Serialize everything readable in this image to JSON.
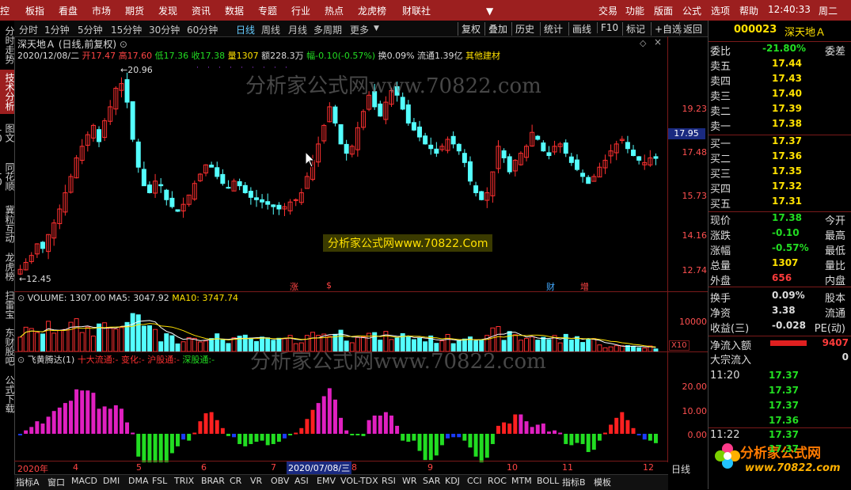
{
  "topbar": {
    "menu": [
      "控",
      "板指",
      "看盘",
      "市场",
      "期货",
      "发现",
      "资讯",
      "数据",
      "专题",
      "行业",
      "热点",
      "龙虎榜",
      "财联社"
    ],
    "right": [
      "交易",
      "功能",
      "版面",
      "公式",
      "选项",
      "帮助"
    ],
    "clock": "12:40:33",
    "weekday": "周二"
  },
  "leftnav": [
    "分时走势",
    "技术分析",
    "图文10",
    "同花顺10",
    "冀粒互动",
    "龙虎榜",
    "扫雷宝",
    "东财股吧",
    "公式下载"
  ],
  "periodbar": {
    "periods": [
      "分时",
      "1分钟",
      "5分钟",
      "15分钟",
      "30分钟",
      "60分钟",
      "日线",
      "周线",
      "月线",
      "多周期",
      "更多"
    ],
    "selected": "日线",
    "tools": [
      "复权",
      "叠加",
      "历史",
      "统计",
      "画线",
      "F10",
      "标记",
      "+自选",
      "返回"
    ]
  },
  "stock": {
    "name": "深天地Ａ",
    "mode": "(日线,前复权)",
    "date": "2020/12/08/二",
    "open_label": "开",
    "open": "17.47",
    "high_label": "高",
    "high": "17.60",
    "low_label": "低",
    "low": "17.36",
    "close_label": "收",
    "close": "17.38",
    "vol_label": "量",
    "vol": "1307",
    "amt_label": "额",
    "amt": "228.3万",
    "chg_label": "幅",
    "chg": "-0.10(-0.57%)",
    "turnover_label": "换",
    "turnover": "0.09%",
    "float_label": "流通",
    "float": "1.39亿",
    "sector": "其他建材"
  },
  "price_axis": [
    "19.23",
    "17.48",
    "15.73",
    "14.16",
    "12.74"
  ],
  "current_price_tag": "17.95",
  "price_marks": {
    "high": "20.96",
    "low": "12.45"
  },
  "event_marks": [
    "涨",
    "$",
    "财",
    "增"
  ],
  "volume": {
    "label": "VOLUME:",
    "value": "1307.00",
    "ma5_label": "MA5:",
    "ma5": "3047.92",
    "ma10_label": "MA10:",
    "ma10": "3747.74",
    "axis": "10000",
    "scale": "X10"
  },
  "indicator": {
    "name": "飞黄腾达(1)",
    "items": [
      {
        "label": "十大流通:",
        "value": "-"
      },
      {
        "label": "变化:",
        "value": "-"
      },
      {
        "label": "沪股通:",
        "value": "-"
      },
      {
        "label": "深股通:",
        "value": "-"
      }
    ],
    "axis": [
      "20.00",
      "10.00",
      "0.00"
    ]
  },
  "date_axis": {
    "year": "2020年",
    "months": [
      "4",
      "5",
      "6",
      "7",
      "8",
      "9",
      "10",
      "11",
      "12"
    ],
    "highlight": "2020/07/08/三"
  },
  "bottom_tabs": [
    "指标A",
    "窗口",
    "MACD",
    "DMI",
    "DMA",
    "FSL",
    "TRIX",
    "BRAR",
    "CR",
    "VR",
    "OBV",
    "ASI",
    "EMV",
    "VOL-TDX",
    "RSI",
    "WR",
    "SAR",
    "KDJ",
    "CCI",
    "ROC",
    "MTM",
    "BOLL",
    "指标B",
    "模板"
  ],
  "bottom_right": "日线",
  "watermarks": [
    "分析家公式网www.70822.com",
    "分析家公式网www.70822.Com",
    "分析家公式网www.70822.com"
  ],
  "right_panel": {
    "code": "000023",
    "name": "深天地Ａ",
    "weibi_label": "委比",
    "weibi": "-21.80%",
    "weicha_label": "委差",
    "sells": [
      {
        "label": "卖五",
        "price": "17.44"
      },
      {
        "label": "卖四",
        "price": "17.43"
      },
      {
        "label": "卖三",
        "price": "17.40"
      },
      {
        "label": "卖二",
        "price": "17.39"
      },
      {
        "label": "卖一",
        "price": "17.38"
      }
    ],
    "buys": [
      {
        "label": "买一",
        "price": "17.37"
      },
      {
        "label": "买二",
        "price": "17.36"
      },
      {
        "label": "买三",
        "price": "17.35"
      },
      {
        "label": "买四",
        "price": "17.32"
      },
      {
        "label": "买五",
        "price": "17.31"
      }
    ],
    "stats": [
      {
        "label": "现价",
        "value": "17.38",
        "right": "今开",
        "color": "green"
      },
      {
        "label": "涨跌",
        "value": "-0.10",
        "right": "最高",
        "color": "green"
      },
      {
        "label": "涨幅",
        "value": "-0.57%",
        "right": "最低",
        "color": "green"
      },
      {
        "label": "总量",
        "value": "1307",
        "right": "量比",
        "color": "yellow"
      },
      {
        "label": "外盘",
        "value": "656",
        "right": "内盘",
        "color": "red"
      },
      {
        "label": "换手",
        "value": "0.09%",
        "right": "股本",
        "color": "white"
      },
      {
        "label": "净资",
        "value": "3.38",
        "right": "流通",
        "color": "white"
      },
      {
        "label": "收益(三)",
        "value": "-0.028",
        "right": "PE(动)",
        "color": "white"
      }
    ],
    "netflow_label": "净流入额",
    "netflow": "9407",
    "bigflow_label": "大宗流入",
    "bigflow": "0",
    "ticks": [
      {
        "time": "11:20",
        "price": "17.37"
      },
      {
        "time": "",
        "price": "17.37"
      },
      {
        "time": "",
        "price": "17.37"
      },
      {
        "time": "",
        "price": "17.36"
      },
      {
        "time": "11:22",
        "price": "17.37"
      },
      {
        "time": "",
        "price": "17.37"
      }
    ],
    "logo_text": "分析家公式网",
    "logo_url": "www.70822.com"
  },
  "colors": {
    "up": "#ff3030",
    "down": "#54ffff",
    "bg": "#000000",
    "menu": "#9c1f1f"
  },
  "chart_data": {
    "type": "candlestick",
    "period": "daily",
    "dates": "2020-04 to 2020-12-08",
    "closes": [
      12.6,
      12.9,
      13.2,
      13.7,
      13.5,
      14.1,
      14.6,
      15.2,
      15.9,
      16.6,
      17.4,
      17.9,
      18.4,
      18.8,
      18.1,
      19.0,
      19.6,
      20.4,
      20.6,
      19.8,
      18.2,
      17.0,
      16.2,
      15.9,
      16.4,
      16.2,
      15.6,
      15.3,
      15.1,
      15.4,
      15.8,
      16.3,
      16.7,
      17.1,
      17.0,
      16.6,
      16.3,
      16.1,
      16.4,
      16.2,
      15.9,
      15.7,
      15.6,
      15.5,
      15.4,
      15.3,
      15.2,
      15.3,
      15.5,
      15.6,
      15.9,
      16.6,
      17.3,
      18.0,
      18.8,
      19.6,
      18.9,
      18.0,
      17.6,
      17.9,
      18.7,
      19.4,
      20.1,
      19.6,
      19.2,
      19.8,
      20.3,
      20.1,
      19.5,
      18.9,
      18.6,
      18.3,
      18.0,
      17.8,
      17.6,
      17.9,
      18.2,
      18.0,
      17.7,
      17.2,
      16.4,
      15.9,
      15.6,
      15.9,
      16.8,
      17.9,
      17.4,
      16.8,
      17.3,
      17.6,
      17.9,
      18.5,
      18.2,
      17.7,
      17.5,
      17.9,
      18.0,
      17.6,
      17.2,
      16.9,
      16.6,
      16.3,
      16.6,
      17.0,
      17.3,
      17.7,
      18.0,
      18.2,
      17.8,
      17.5,
      17.3,
      17.2,
      17.4,
      17.38
    ],
    "volume_ma": {
      "ma5": 3047.92,
      "ma10": 3747.74,
      "last": 1307
    }
  }
}
